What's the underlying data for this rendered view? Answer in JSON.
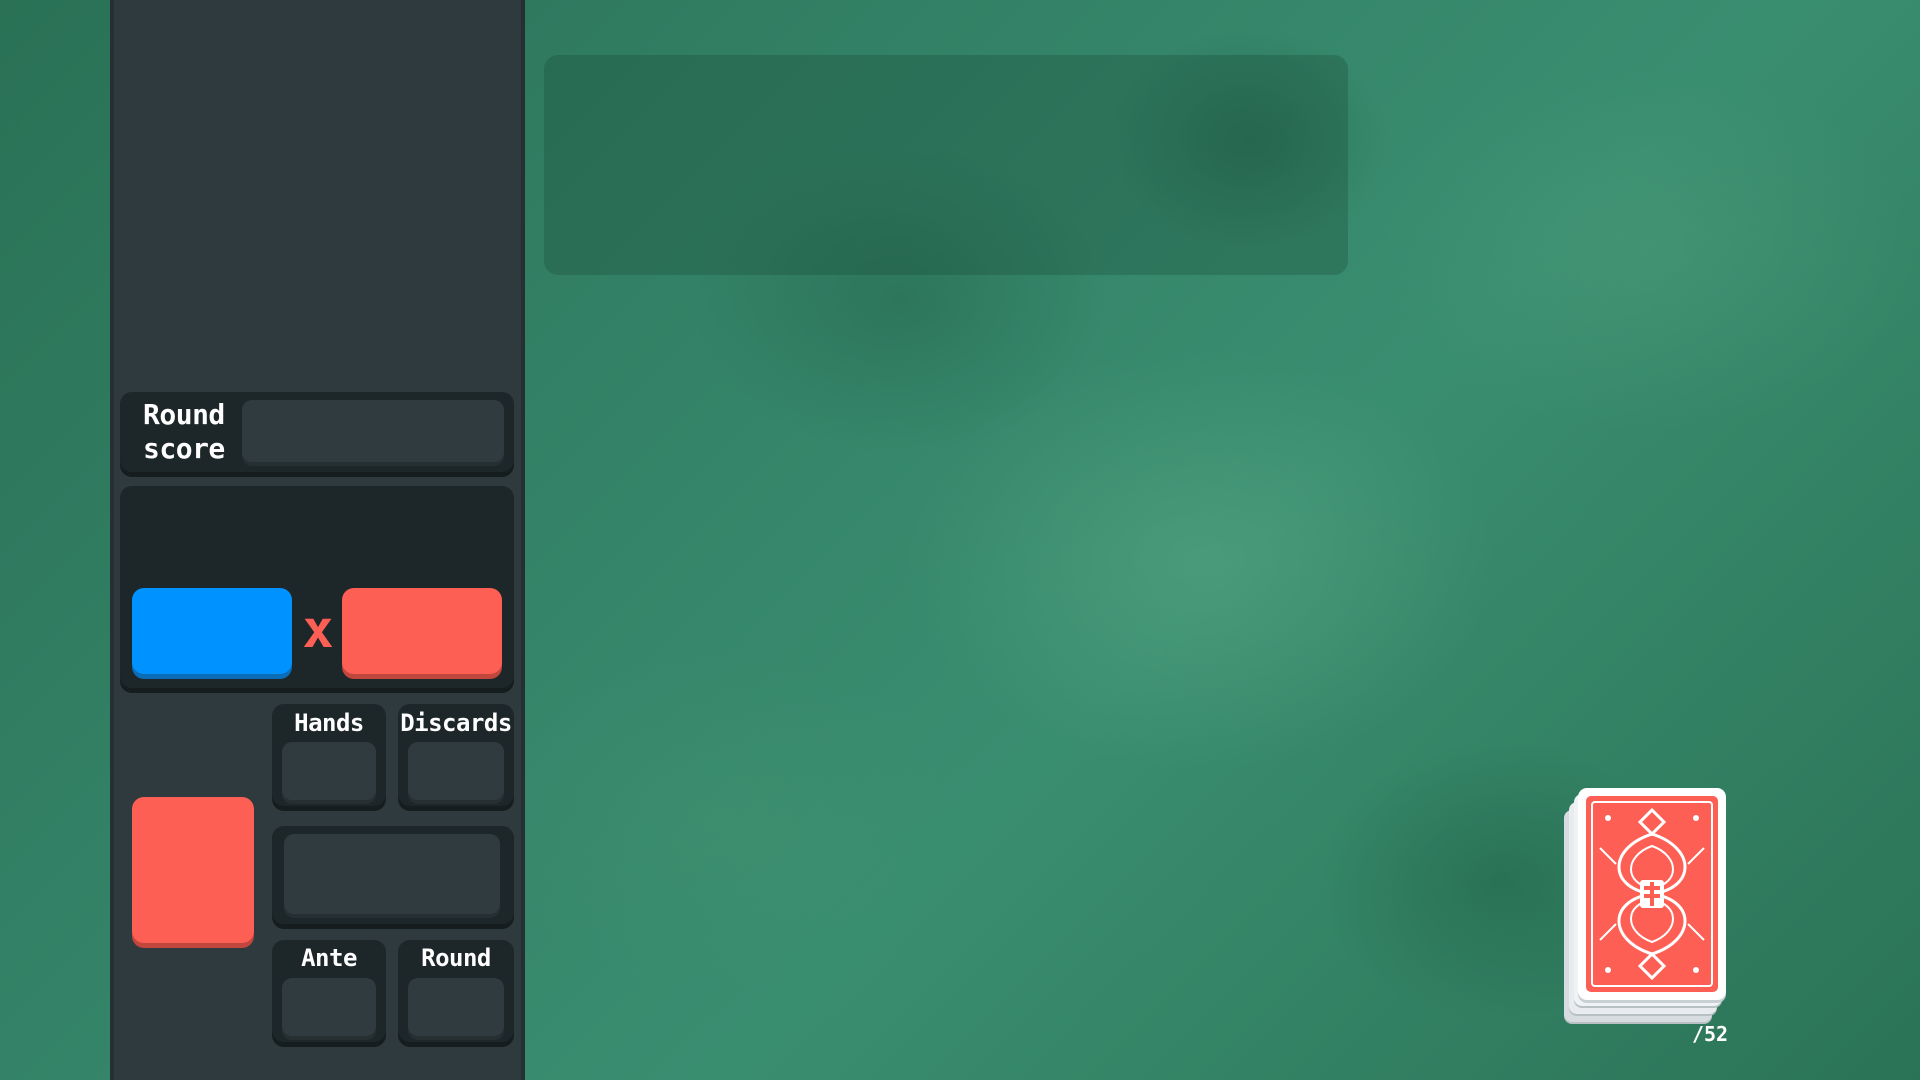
{
  "hud": {
    "round_score_label": "Round score",
    "round_score_value": "",
    "chips_value": "",
    "mult_value": "",
    "multiplier_symbol": "x",
    "hands_label": "Hands",
    "hands_value": "",
    "discards_label": "Discards",
    "discards_value": "",
    "money_value": "",
    "ante_label": "Ante",
    "ante_value": "",
    "round_label": "Round",
    "round_value": ""
  },
  "deck": {
    "count_text": "/52"
  },
  "colors": {
    "chips": "#0093ff",
    "mult": "#fe5f55",
    "sidebar": "#2e3a3d",
    "felt": "#2f7a5e",
    "card_back": "#fe5f55"
  },
  "icons": [
    "multiply-icon",
    "card-back-icon"
  ]
}
